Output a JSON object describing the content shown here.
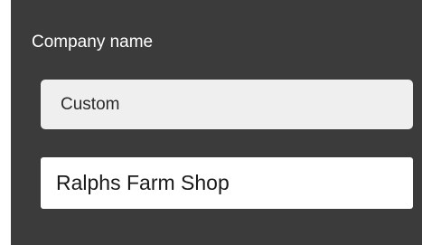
{
  "company_name": {
    "label": "Company name",
    "type_select": {
      "selected": "Custom"
    },
    "input": {
      "value": "Ralphs Farm Shop"
    }
  }
}
